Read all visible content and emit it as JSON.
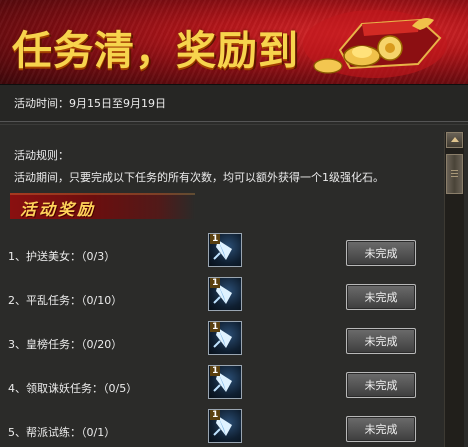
{
  "banner": {
    "title": "任务清，奖励到"
  },
  "activity": {
    "time": "活动时间：9月15日至9月19日"
  },
  "rules": {
    "title": "活动规则：",
    "text": "活动期间，只要完成以下任务的所有次数，均可以额外获得一个1级强化石。"
  },
  "rewards": {
    "section_title": "活动奖励",
    "tasks": [
      {
        "label": "1、护送美女：（0/3）",
        "reward_count": "1",
        "status": "未完成"
      },
      {
        "label": "2、平乱任务：（0/10）",
        "reward_count": "1",
        "status": "未完成"
      },
      {
        "label": "3、皇榜任务：（0/20）",
        "reward_count": "1",
        "status": "未完成"
      },
      {
        "label": "4、领取诛妖任务：（0/5）",
        "reward_count": "1",
        "status": "未完成"
      },
      {
        "label": "5、帮派试练：（0/1）",
        "reward_count": "1",
        "status": "未完成"
      }
    ]
  },
  "icons": {
    "reward_item": "enhancement-stone-icon",
    "scroll_up": "arrow-up-icon"
  },
  "colors": {
    "banner_red": "#b4161a",
    "title_gold": "#f7d44d",
    "section_gold": "#ffd35a",
    "button_gray": "#5a5a5a"
  }
}
